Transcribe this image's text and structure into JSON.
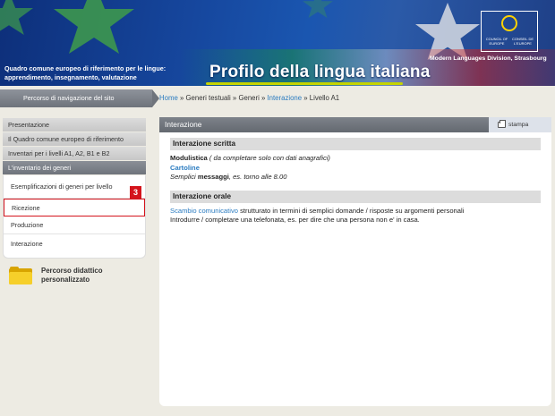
{
  "header": {
    "tagline_line1": "Quadro comune europeo di riferimento per le lingue:",
    "tagline_line2": "apprendimento, insegnamento, valutazione",
    "title": "Profilo della lingua italiana",
    "coe_left": "COUNCIL OF EUROPE",
    "coe_right": "CONSEIL DE L'EUROPE",
    "division": "Modern Languages Division, Strasbourg"
  },
  "navbar": {
    "label": "Percorso di navigazione del sito"
  },
  "breadcrumb": {
    "home": "Home",
    "sep": " » ",
    "generi_testuali": "Generi testuali",
    "generi": "Generi",
    "interazione": "Interazione",
    "current": "Livello A1"
  },
  "sidebar": {
    "items": [
      {
        "label": "Presentazione"
      },
      {
        "label": "Il Quadro comune europeo di riferimento"
      },
      {
        "label": "Inventari per i livelli A1, A2, B1 e B2"
      },
      {
        "label": "L'inventario dei generi"
      }
    ],
    "subitems": [
      {
        "label": "Esemplificazioni di generi per livello"
      },
      {
        "label": "Ricezione"
      },
      {
        "label": "Produzione"
      },
      {
        "label": "Interazione"
      }
    ],
    "badge": "3",
    "percorso_line1": "Percorso didattico",
    "percorso_line2": "personalizzato"
  },
  "main": {
    "title": "Interazione",
    "print_label": "stampa",
    "sections": [
      {
        "heading": "Interazione scritta",
        "modulistica": "Modulistica",
        "modulistica_note": " ( da completare solo con dati anagrafici)",
        "cartoline": "Cartoline",
        "semplici_a": "Semplici ",
        "semplici_b": "messaggi",
        "semplici_c": ", es. torno alle 8.00"
      },
      {
        "heading": "Interazione orale",
        "scambio_link": "Scambio comunicativo",
        "scambio_rest": " strutturato in termini di semplici domande / risposte su argomenti personali",
        "telefonata": "Introdurre / completare una telefonata, es. per dire che una persona non e' in casa."
      }
    ]
  },
  "colors": {
    "banner_blue": "#1a56b0",
    "link_blue": "#2a7bc0",
    "highlight_red": "#d4141c",
    "title_underline": "#c5d400"
  }
}
